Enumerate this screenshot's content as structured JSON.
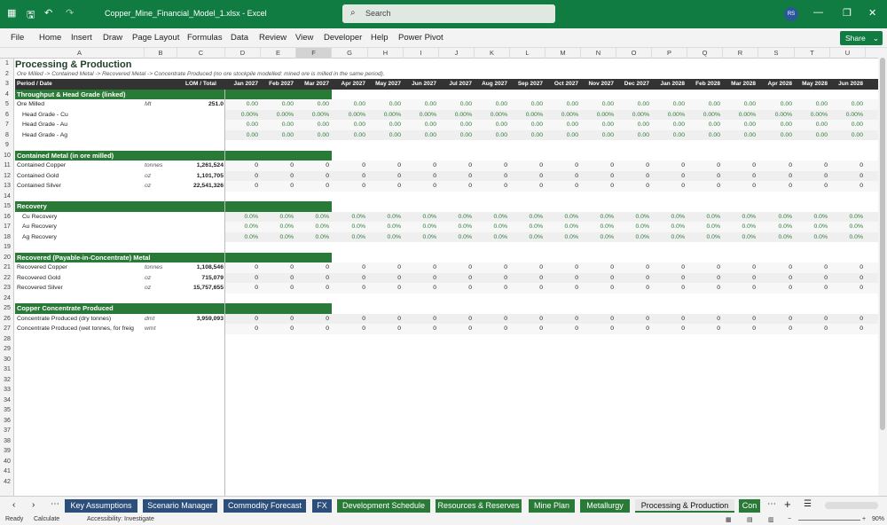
{
  "app": {
    "doc_title": "Copper_Mine_Financial_Model_1.xlsx - Excel",
    "search_placeholder": "Search",
    "avatar": "RS",
    "share": "Share"
  },
  "menu": [
    "File",
    "Home",
    "Insert",
    "Draw",
    "Page Layout",
    "Formulas",
    "Data",
    "Review",
    "View",
    "Developer",
    "Help",
    "Power Pivot"
  ],
  "columns": [
    "A",
    "B",
    "C",
    "D",
    "E",
    "F",
    "G",
    "H",
    "I",
    "J",
    "K",
    "L",
    "M",
    "N",
    "O",
    "P",
    "Q",
    "R",
    "S",
    "T",
    "U"
  ],
  "sheet": {
    "title": "Processing & Production",
    "subtitle": "Ore Milled -> Contained Metal -> Recovered Metal -> Concentrate Produced (no ore stockpile modelled: mined ore is milled in the same period).",
    "period_label": "Period / Date",
    "lom_label": "LOM / Total",
    "periods": [
      "Jan 2027",
      "Feb 2027",
      "Mar 2027",
      "Apr 2027",
      "May 2027",
      "Jun 2027",
      "Jul 2027",
      "Aug 2027",
      "Sep 2027",
      "Oct 2027",
      "Nov 2027",
      "Dec 2027",
      "Jan 2028",
      "Feb 2028",
      "Mar 2028",
      "Apr 2028",
      "May 2028",
      "Jun 2028"
    ],
    "sections": {
      "r4": "Throughput & Head Grade (linked)",
      "r10": "Contained Metal (in ore milled)",
      "r15": "Recovery",
      "r20": "Recovered (Payable-in-Concentrate) Metal",
      "r25": "Copper Concentrate Produced"
    },
    "rows": [
      {
        "r": 5,
        "label": "Ore Milled",
        "unit": "Mt",
        "lom": "251.0",
        "val": "0.00"
      },
      {
        "r": 6,
        "label": "Head Grade - Cu",
        "unit": "",
        "lom": "",
        "val": "0.00%",
        "indent": true
      },
      {
        "r": 7,
        "label": "Head Grade - Au",
        "unit": "",
        "lom": "",
        "val": "0.00",
        "indent": true
      },
      {
        "r": 8,
        "label": "Head Grade - Ag",
        "unit": "",
        "lom": "",
        "val": "0.00",
        "indent": true
      },
      {
        "r": 11,
        "label": "Contained Copper",
        "unit": "tonnes",
        "lom": "1,261,524",
        "val": "0"
      },
      {
        "r": 12,
        "label": "Contained Gold",
        "unit": "oz",
        "lom": "1,101,705",
        "val": "0"
      },
      {
        "r": 13,
        "label": "Contained Silver",
        "unit": "oz",
        "lom": "22,541,326",
        "val": "0"
      },
      {
        "r": 16,
        "label": "Cu Recovery",
        "unit": "",
        "lom": "",
        "val": "0.0%",
        "indent": true
      },
      {
        "r": 17,
        "label": "Au Recovery",
        "unit": "",
        "lom": "",
        "val": "0.0%",
        "indent": true
      },
      {
        "r": 18,
        "label": "Ag Recovery",
        "unit": "",
        "lom": "",
        "val": "0.0%",
        "indent": true
      },
      {
        "r": 21,
        "label": "Recovered Copper",
        "unit": "tonnes",
        "lom": "1,108,546",
        "val": "0"
      },
      {
        "r": 22,
        "label": "Recovered Gold",
        "unit": "oz",
        "lom": "715,079",
        "val": "0"
      },
      {
        "r": 23,
        "label": "Recovered Silver",
        "unit": "oz",
        "lom": "15,757,655",
        "val": "0"
      },
      {
        "r": 26,
        "label": "Concentrate Produced (dry tonnes)",
        "unit": "dmt",
        "lom": "3,959,093",
        "val": "0"
      },
      {
        "r": 27,
        "label": "Concentrate Produced (wet tonnes, for freig",
        "unit": "wmt",
        "lom": "",
        "val": "0"
      }
    ]
  },
  "tabs": [
    "Key Assumptions",
    "Scenario Manager",
    "Commodity Forecast",
    "FX",
    "Development Schedule",
    "Resources & Reserves",
    "Mine Plan",
    "Metallurgy",
    "Processing & Production",
    "Con"
  ],
  "status": {
    "ready": "Ready",
    "calc": "Calculate",
    "access": "Accessibility: Investigate",
    "zoom": "90%"
  }
}
